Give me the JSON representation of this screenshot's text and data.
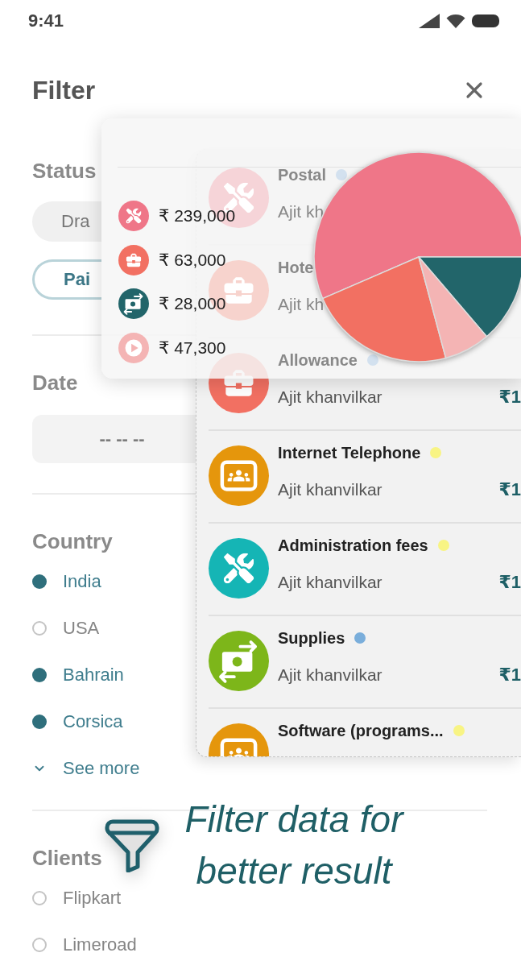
{
  "status_bar": {
    "time": "9:41"
  },
  "filter": {
    "title": "Filter",
    "status": {
      "label": "Status",
      "chips": [
        {
          "label": "Dra",
          "selected": false
        },
        {
          "label": "Pai",
          "selected": true
        }
      ]
    },
    "date": {
      "label": "Date",
      "placeholder": "-- -- --"
    },
    "country": {
      "label": "Country",
      "options": [
        {
          "label": "India",
          "checked": true
        },
        {
          "label": "USA",
          "checked": false
        },
        {
          "label": "Bahrain",
          "checked": true
        },
        {
          "label": "Corsica",
          "checked": true
        }
      ],
      "see_more": "See more"
    },
    "clients": {
      "label": "Clients",
      "options": [
        {
          "label": "Flipkart",
          "checked": false
        },
        {
          "label": "Limeroad",
          "checked": false
        }
      ]
    }
  },
  "expense_list": {
    "rows": [
      {
        "icon": {
          "kind": "tools",
          "color": "#f6d4d8"
        },
        "title": "Postal",
        "color": "#d3e1ef",
        "subtitle": "Ajit kh"
      },
      {
        "icon": {
          "kind": "briefcase",
          "color": "#f7d3cd"
        },
        "title": "Hote",
        "subtitle": "Ajit kh"
      },
      {
        "icon": {
          "kind": "briefcase",
          "color": "#f27062"
        },
        "title": "Allowance",
        "color": "#d3e1ef",
        "subtitle": "Ajit khanvilkar",
        "amount": "₹1"
      },
      {
        "icon": {
          "kind": "people",
          "color": "#e5960c"
        },
        "title": "Internet Telephone",
        "color": "#f8f484",
        "subtitle": "Ajit khanvilkar",
        "amount": "₹1"
      },
      {
        "icon": {
          "kind": "tools",
          "color": "#15b5b5"
        },
        "title": "Administration fees",
        "color": "#f8f484",
        "subtitle": "Ajit khanvilkar",
        "amount": "₹1"
      },
      {
        "icon": {
          "kind": "cash",
          "color": "#7db61a"
        },
        "title": "Supplies",
        "color": "#7aaedb",
        "subtitle": "Ajit khanvilkar",
        "amount": "₹1"
      },
      {
        "icon": {
          "kind": "people",
          "color": "#e5960c"
        },
        "title": "Software (programs...",
        "color": "#f8f484"
      }
    ]
  },
  "chart_card": {
    "legend": [
      {
        "kind": "tools",
        "color": "#ef7688",
        "amount": "₹ 239,000"
      },
      {
        "kind": "briefcase",
        "color": "#f27062",
        "amount": "₹ 63,000"
      },
      {
        "kind": "cash",
        "color": "#22656a",
        "amount": "₹ 28,000"
      },
      {
        "kind": "play",
        "color": "#f4b4b4",
        "amount": "₹ 47,300"
      }
    ]
  },
  "caption": "Filter data for better result"
}
